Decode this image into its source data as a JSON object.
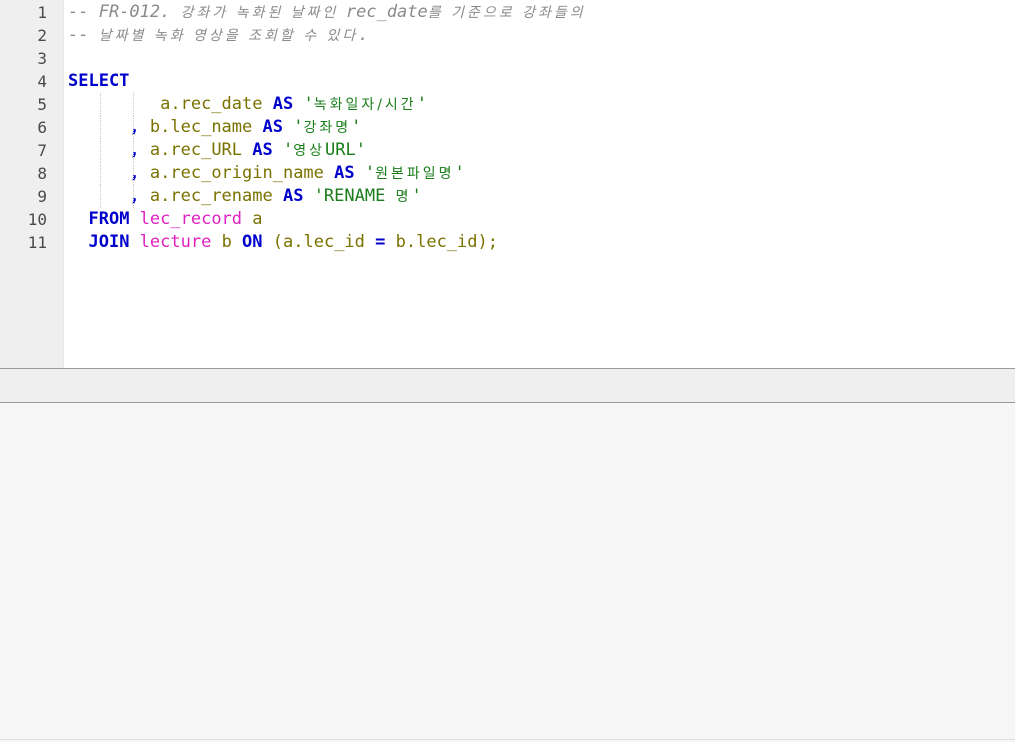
{
  "editor": {
    "lines": [
      {
        "n": "1",
        "tokens": [
          {
            "c": "cm",
            "t": "-- FR-012. "
          },
          {
            "c": "cm ko",
            "t": "강좌가 녹화된 날짜인 "
          },
          {
            "c": "cm",
            "t": "rec_date"
          },
          {
            "c": "cm ko",
            "t": "를 기준으로 강좌들의"
          }
        ]
      },
      {
        "n": "2",
        "tokens": [
          {
            "c": "cm",
            "t": "-- "
          },
          {
            "c": "cm ko",
            "t": "날짜별 녹화 영상을 조회할 수 있다"
          },
          {
            "c": "cm",
            "t": "."
          }
        ]
      },
      {
        "n": "3",
        "tokens": []
      },
      {
        "n": "4",
        "tokens": [
          {
            "c": "kw",
            "t": "SELECT"
          }
        ]
      },
      {
        "n": "5",
        "tokens": [
          {
            "c": "pn",
            "t": "         "
          },
          {
            "c": "id",
            "t": "a.rec_date "
          },
          {
            "c": "kw",
            "t": "AS "
          },
          {
            "c": "st",
            "t": "'"
          },
          {
            "c": "st ko",
            "t": "녹화일자/시간"
          },
          {
            "c": "st",
            "t": "'"
          }
        ]
      },
      {
        "n": "6",
        "tokens": [
          {
            "c": "pn",
            "t": "      "
          },
          {
            "c": "kw",
            "t": ", "
          },
          {
            "c": "id",
            "t": "b.lec_name "
          },
          {
            "c": "kw",
            "t": "AS "
          },
          {
            "c": "st",
            "t": "'"
          },
          {
            "c": "st ko",
            "t": "강좌명"
          },
          {
            "c": "st",
            "t": "'"
          }
        ]
      },
      {
        "n": "7",
        "tokens": [
          {
            "c": "pn",
            "t": "      "
          },
          {
            "c": "kw",
            "t": ", "
          },
          {
            "c": "id",
            "t": "a.rec_URL "
          },
          {
            "c": "kw",
            "t": "AS "
          },
          {
            "c": "st",
            "t": "'"
          },
          {
            "c": "st ko",
            "t": "영상"
          },
          {
            "c": "st",
            "t": "URL'"
          }
        ]
      },
      {
        "n": "8",
        "tokens": [
          {
            "c": "pn",
            "t": "      "
          },
          {
            "c": "kw",
            "t": ", "
          },
          {
            "c": "id",
            "t": "a.rec_origin_name "
          },
          {
            "c": "kw",
            "t": "AS "
          },
          {
            "c": "st",
            "t": "'"
          },
          {
            "c": "st ko",
            "t": "원본파일명"
          },
          {
            "c": "st",
            "t": "'"
          }
        ]
      },
      {
        "n": "9",
        "tokens": [
          {
            "c": "pn",
            "t": "      "
          },
          {
            "c": "kw",
            "t": ", "
          },
          {
            "c": "id",
            "t": "a.rec_rename "
          },
          {
            "c": "kw",
            "t": "AS "
          },
          {
            "c": "st",
            "t": "'RENAME "
          },
          {
            "c": "st ko",
            "t": "명"
          },
          {
            "c": "st",
            "t": "'"
          }
        ]
      },
      {
        "n": "10",
        "tokens": [
          {
            "c": "pn",
            "t": "  "
          },
          {
            "c": "kw",
            "t": "FROM "
          },
          {
            "c": "tb",
            "t": "lec_record "
          },
          {
            "c": "id",
            "t": "a"
          }
        ]
      },
      {
        "n": "11",
        "tokens": [
          {
            "c": "pn",
            "t": "  "
          },
          {
            "c": "kw",
            "t": "JOIN "
          },
          {
            "c": "tb",
            "t": "lecture "
          },
          {
            "c": "id",
            "t": "b "
          },
          {
            "c": "kw",
            "t": "ON "
          },
          {
            "c": "id",
            "t": "("
          },
          {
            "c": "id",
            "t": "a.lec_id "
          },
          {
            "c": "kw",
            "t": "= "
          },
          {
            "c": "id",
            "t": "b.lec_id"
          },
          {
            "c": "id",
            "t": ");"
          }
        ]
      }
    ]
  }
}
